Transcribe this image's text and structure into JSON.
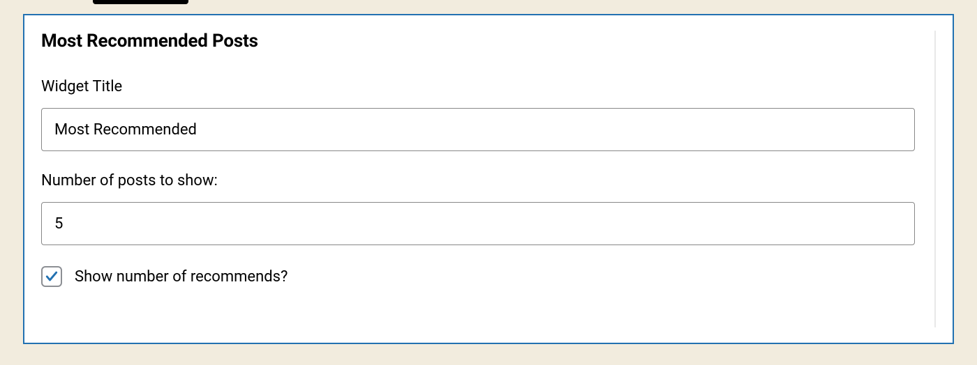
{
  "widget": {
    "heading": "Most Recommended Posts",
    "title_label": "Widget Title",
    "title_value": "Most Recommended",
    "count_label": "Number of posts to show:",
    "count_value": "5",
    "show_recommends_label": "Show number of recommends?",
    "show_recommends_checked": true
  }
}
